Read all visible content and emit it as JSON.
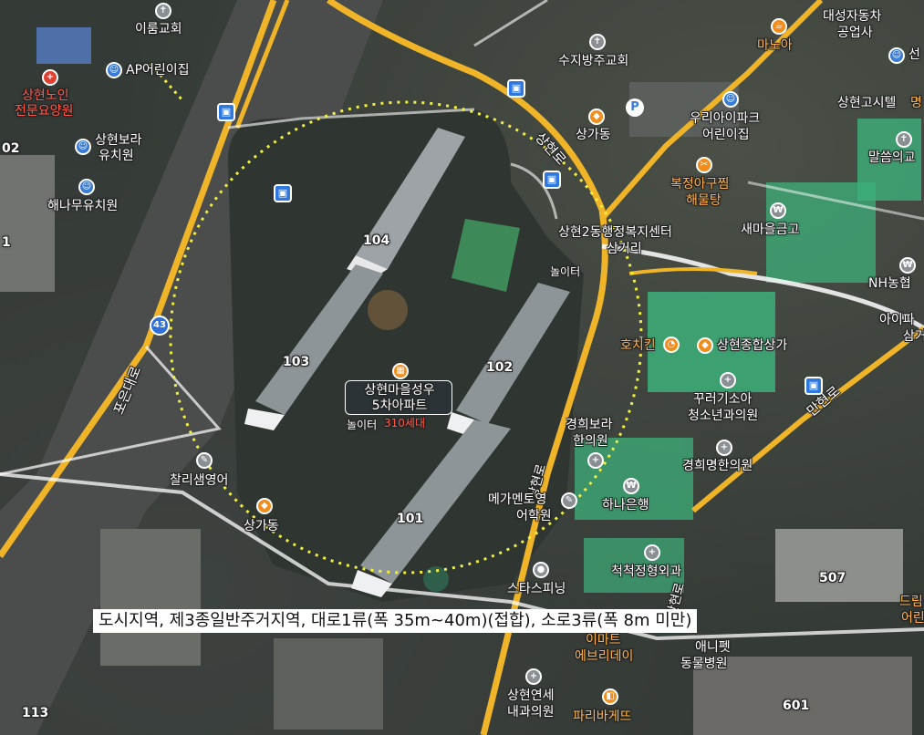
{
  "caption": "도시지역, 제3종일반주거지역, 대로1류(폭 35m~40m)(접합), 소로3류(폭 8m 미만)",
  "target": {
    "name_line1": "상현마을성우",
    "name_line2": "5차아파트",
    "households": "310세대",
    "playground": "놀이터"
  },
  "buildings": [
    "104",
    "103",
    "102",
    "101"
  ],
  "other_numbers": [
    "507",
    "113",
    "601",
    "02",
    "1"
  ],
  "roads": [
    "포은대로",
    "상현로",
    "만현로",
    "43"
  ],
  "places": {
    "irum_church": "이룸교회",
    "ap_kindergarten": "AP어린이집",
    "nursing_home_1": "상현노인",
    "nursing_home_2": "전문요양원",
    "bora_kinder_1": "상현보라",
    "bora_kinder_2": "유치원",
    "hanamu_kinder": "해나무유치원",
    "suji_church": "수지방주교회",
    "manoa": "마노아",
    "daesung_1": "대성자동차",
    "daesung_2": "공업사",
    "sangga_top": "상가동",
    "woori_1": "우리아이파크",
    "woori_2": "어린이집",
    "sanghyun_hotel": "상현고시텔",
    "malsseum": "말씀의교",
    "bokjeong_1": "복정아구찜",
    "bokjeong_2": "해물탕",
    "welfare_center": "상현2동행정복지센터",
    "samgeori": "삼거리",
    "saemaeul": "새마을금고",
    "playground_right": "놀이터",
    "nh_bank": "NH농협",
    "ipark_1": "아이파",
    "ipark_2": "삼거",
    "hochicken": "호치킨",
    "sanghyun_mall": "상현종합상가",
    "ggureogi_1": "꾸러기소아",
    "ggureogi_2": "청소년과의원",
    "kyunghee_bora_1": "경희보라",
    "kyunghee_bora_2": "한의원",
    "kyunghee_myung": "경희명한의원",
    "charisaem": "찰리샘영어",
    "sangga_bottom": "상가동",
    "mega_1": "메가멘토영",
    "mega_2": "어학원",
    "hana_bank": "하나은행",
    "cheokcheok": "척척정형외과",
    "spinning": "스타스피닝",
    "emart_1": "이마트",
    "emart_2": "에브리데이",
    "anipet_1": "애니펫",
    "anipet_2": "동물병원",
    "sanghyun_clinic_1": "상현연세",
    "sanghyun_clinic_2": "내과의원",
    "paris": "파리바게뜨",
    "dream_1": "드림",
    "dream_2": "어린",
    "myeong": "명",
    "seon": "선"
  },
  "icons": {
    "church": "church-icon",
    "kindergarten": "kindergarten-icon",
    "hospital": "hospital-icon",
    "shop": "shopping-icon",
    "bus": "bus-stop-icon",
    "parking": "parking-icon",
    "bank": "bank-icon",
    "food": "restaurant-icon",
    "building": "apartment-icon"
  },
  "colors": {
    "main_road": "#f0b428",
    "circle": "#f2f03a",
    "bus": "#2f78e0",
    "roof_green": "#3db07a"
  }
}
